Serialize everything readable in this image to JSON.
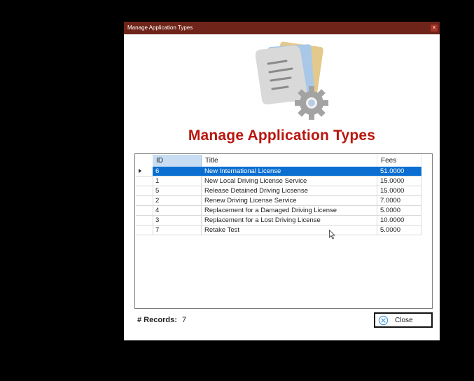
{
  "window": {
    "title": "Manage Application Types",
    "close_glyph": "x"
  },
  "heading": "Manage Application Types",
  "grid": {
    "columns": [
      "ID",
      "Title",
      "Fees"
    ],
    "rows": [
      {
        "id": "6",
        "title": "New International License",
        "fees": "51.0000",
        "selected": true
      },
      {
        "id": "1",
        "title": "New Local Driving License Service",
        "fees": "15.0000"
      },
      {
        "id": "5",
        "title": "Release Detained Driving Licsense",
        "fees": "15.0000"
      },
      {
        "id": "2",
        "title": "Renew Driving License Service",
        "fees": "7.0000"
      },
      {
        "id": "4",
        "title": "Replacement for a Damaged Driving License",
        "fees": "5.0000"
      },
      {
        "id": "3",
        "title": "Replacement for a Lost Driving License",
        "fees": "10.0000"
      },
      {
        "id": "7",
        "title": "Retake Test",
        "fees": "5.0000"
      }
    ]
  },
  "footer": {
    "records_label": "# Records:",
    "records_value": "7",
    "close_label": "Close"
  },
  "colors": {
    "titlebar": "#6e2418",
    "heading": "#b8160e",
    "selection": "#0a6fd1"
  }
}
